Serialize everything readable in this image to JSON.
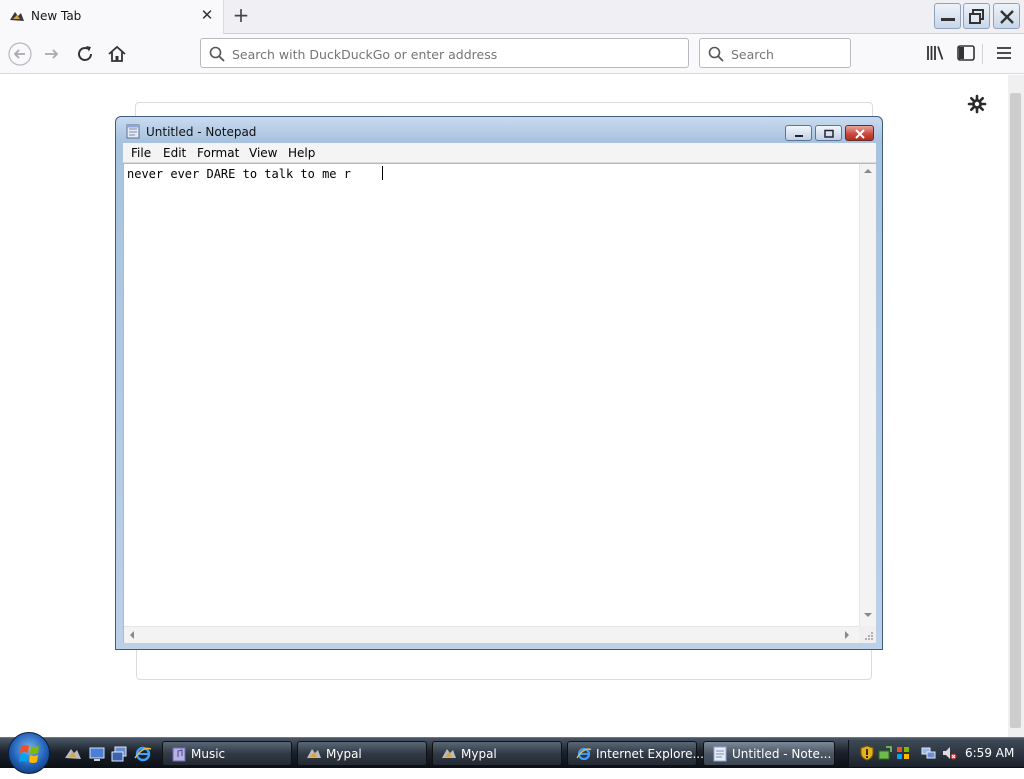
{
  "browser": {
    "tab_title": "New Tab",
    "tab_close_glyph": "✕",
    "new_tab_glyph": "+",
    "url_placeholder": "Search with DuckDuckGo or enter address",
    "search_placeholder": "Search"
  },
  "notepad": {
    "title": "Untitled - Notepad",
    "menu": {
      "file": "File",
      "edit": "Edit",
      "format": "Format",
      "view": "View",
      "help": "Help"
    },
    "text": "never ever DARE to talk to me r "
  },
  "taskbar": {
    "items": [
      {
        "label": "Music",
        "icon": "music-folder-icon"
      },
      {
        "label": "Mypal",
        "icon": "mypal-icon"
      },
      {
        "label": "Mypal",
        "icon": "mypal-icon"
      },
      {
        "label": "Internet Explore...",
        "icon": "internet-explorer-icon"
      },
      {
        "label": "Untitled - Note...",
        "icon": "notepad-icon",
        "active": true
      }
    ],
    "clock": "6:59 AM"
  },
  "colors": {
    "accent": "#1f5fb5",
    "taskbar": "#1c232d",
    "close_button": "#c8453a"
  }
}
